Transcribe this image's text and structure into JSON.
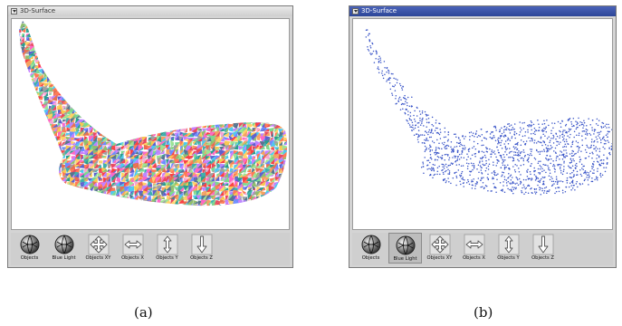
{
  "panels": [
    {
      "window_title": "3D-Surface",
      "caption": "(a)",
      "toolbar": [
        {
          "label": "Objects",
          "icon": "sphere-icon",
          "pressed": false
        },
        {
          "label": "Blue Light",
          "icon": "light-sphere-icon",
          "pressed": false
        },
        {
          "label": "Objects XY",
          "icon": "move-xy-icon",
          "pressed": false
        },
        {
          "label": "Objects X",
          "icon": "move-x-icon",
          "pressed": false
        },
        {
          "label": "Objects Y",
          "icon": "move-y-icon",
          "pressed": false
        },
        {
          "label": "Objects Z",
          "icon": "move-z-icon",
          "pressed": false
        }
      ],
      "render_style": "colored-triangle-mesh"
    },
    {
      "window_title": "3D-Surface",
      "caption": "(b)",
      "toolbar": [
        {
          "label": "Objects",
          "icon": "sphere-icon",
          "pressed": false
        },
        {
          "label": "Blue Light",
          "icon": "light-sphere-icon",
          "pressed": true
        },
        {
          "label": "Objects XY",
          "icon": "move-xy-icon",
          "pressed": false
        },
        {
          "label": "Objects X",
          "icon": "move-x-icon",
          "pressed": false
        },
        {
          "label": "Objects Y",
          "icon": "move-y-icon",
          "pressed": false
        },
        {
          "label": "Objects Z",
          "icon": "move-z-icon",
          "pressed": false
        }
      ],
      "render_style": "point-cloud",
      "point_color": "#3a55c8"
    }
  ]
}
